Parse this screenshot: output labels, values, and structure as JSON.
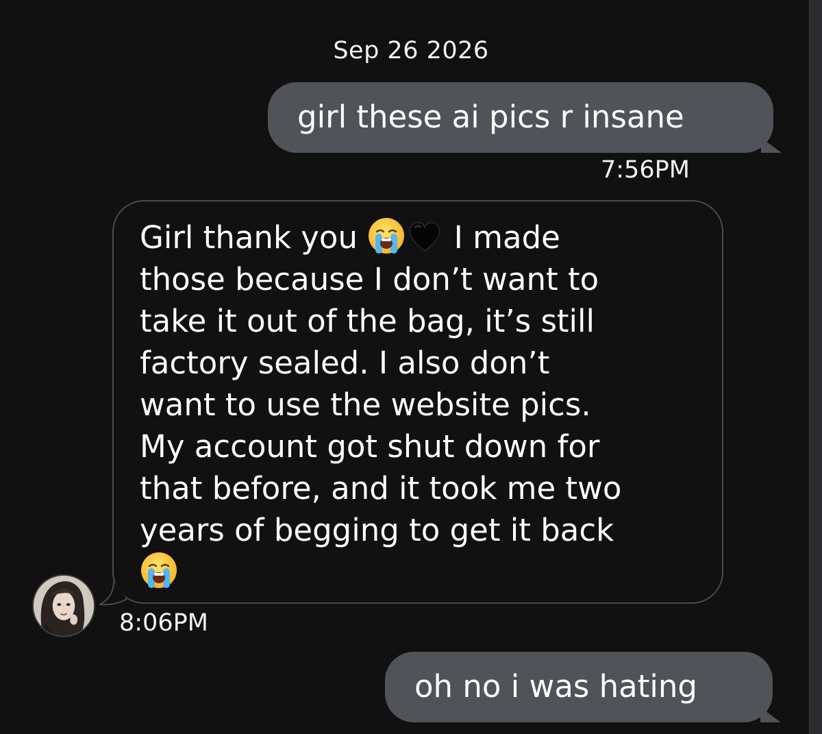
{
  "conversation": {
    "date": "Sep 26 2026",
    "messages": [
      {
        "direction": "outgoing",
        "text": "girl these ai pics r insane",
        "time": "7:56PM"
      },
      {
        "direction": "incoming",
        "text_parts": [
          "Girl thank you ",
          "I made",
          "those because I don’t want to",
          "take it out of the bag, it’s still",
          "factory sealed. I also don’t",
          "want to use the website pics.",
          "My account got shut down for",
          "that before, and it took me two",
          "years of begging to get it back"
        ],
        "emojis": [
          "loudly-crying-face",
          "black-heart",
          "loudly-crying-face"
        ],
        "time": "8:06PM"
      },
      {
        "direction": "outgoing",
        "text": "oh no i was hating"
      }
    ]
  },
  "colors": {
    "background": "#111111",
    "outgoing_bubble": "#505358",
    "incoming_bubble_border": "#4b4b4f",
    "text": "#ffffff"
  }
}
